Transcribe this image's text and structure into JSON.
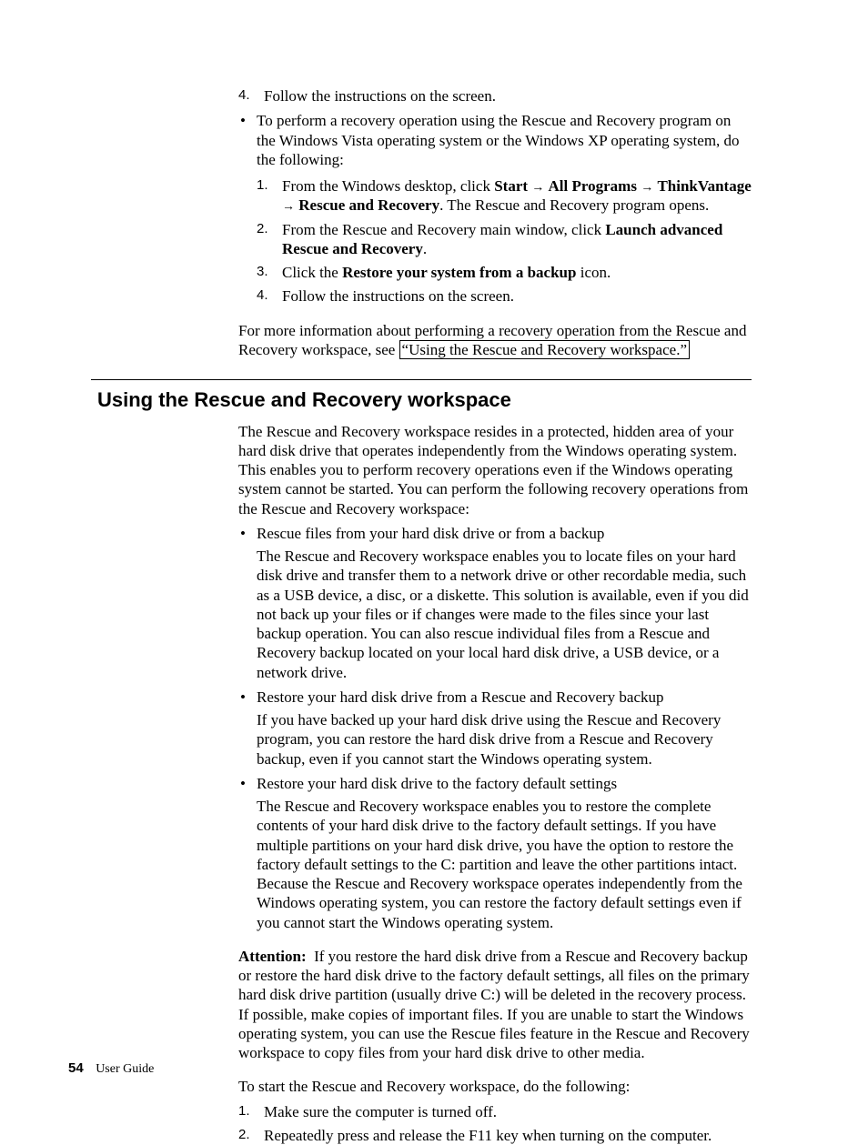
{
  "top": {
    "step4": "Follow the instructions on the screen.",
    "bullet_intro": "To perform a recovery operation using the Rescue and Recovery program on the Windows Vista operating system or the Windows XP operating system, do the following:",
    "s1_a": "From the Windows desktop, click ",
    "s1_b": "Start",
    "s1_c": "All Programs",
    "s1_d": "ThinkVantage",
    "s1_e": "Rescue and Recovery",
    "s1_f": ". The Rescue and Recovery program opens.",
    "s2_a": "From the Rescue and Recovery main window, click ",
    "s2_b": "Launch advanced Rescue and Recovery",
    "s2_c": ".",
    "s3_a": "Click the ",
    "s3_b": "Restore your system from a backup",
    "s3_c": " icon.",
    "s4": "Follow the instructions on the screen.",
    "after_a": "For more information about performing a recovery operation from the Rescue and Recovery workspace, see ",
    "after_link": "“Using the Rescue and Recovery workspace.”"
  },
  "sec": {
    "heading": "Using the Rescue and Recovery workspace",
    "intro": "The Rescue and Recovery workspace resides in a protected, hidden area of your hard disk drive that operates independently from the Windows operating system. This enables you to perform recovery operations even if the Windows operating system cannot be started. You can perform the following recovery operations from the Rescue and Recovery workspace:",
    "b1_head": "Rescue files from your hard disk drive or from a backup",
    "b1_body": "The Rescue and Recovery workspace enables you to locate files on your hard disk drive and transfer them to a network drive or other recordable media, such as a USB device, a disc, or a diskette. This solution is available, even if you did not back up your files or if changes were made to the files since your last backup operation. You can also rescue individual files from a Rescue and Recovery backup located on your local hard disk drive, a USB device, or a network drive.",
    "b2_head": "Restore your hard disk drive from a Rescue and Recovery backup",
    "b2_body": "If you have backed up your hard disk drive using the Rescue and Recovery program, you can restore the hard disk drive from a Rescue and Recovery backup, even if you cannot start the Windows operating system.",
    "b3_head": "Restore your hard disk drive to the factory default settings",
    "b3_body": "The Rescue and Recovery workspace enables you to restore the complete contents of your hard disk drive to the factory default settings. If you have multiple partitions on your hard disk drive, you have the option to restore the factory default settings to the C: partition and leave the other partitions intact. Because the Rescue and Recovery workspace operates independently from the Windows operating system, you can restore the factory default settings even if you cannot start the Windows operating system.",
    "attn_label": "Attention:",
    "attn_body": "If you restore the hard disk drive from a Rescue and Recovery backup or restore the hard disk drive to the factory default settings, all files on the primary hard disk drive partition (usually drive C:) will be deleted in the recovery process. If possible, make copies of important files. If you are unable to start the Windows operating system, you can use the Rescue files feature in the Rescue and Recovery workspace to copy files from your hard disk drive to other media.",
    "start_intro": "To start the Rescue and Recovery workspace, do the following:",
    "st1": "Make sure the computer is turned off.",
    "st2": "Repeatedly press and release the F11 key when turning on the computer."
  },
  "footer": {
    "page": "54",
    "title": "User Guide"
  },
  "g": {
    "arrow": "→"
  }
}
